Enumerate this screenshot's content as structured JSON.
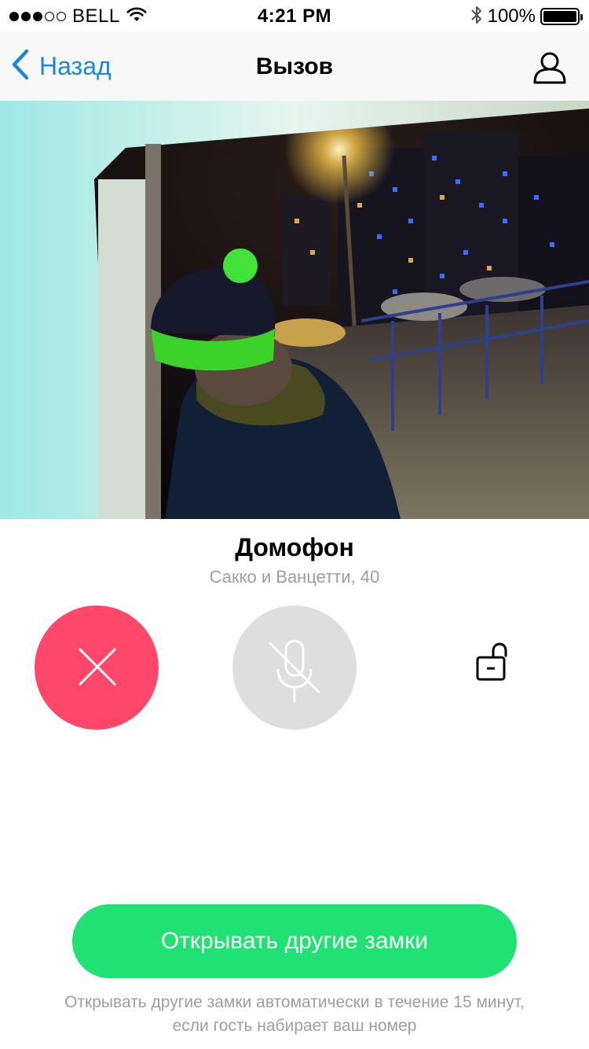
{
  "status_bar": {
    "carrier": "BELL",
    "time": "4:21 PM",
    "battery": "100%",
    "signal_bars_filled": 3,
    "signal_bars_total": 5
  },
  "nav": {
    "back_label": "Назад",
    "title": "Вызов",
    "profile_icon": "user-icon"
  },
  "caller": {
    "name": "Домофон",
    "address": "Сакко и Ванцетти, 40"
  },
  "actions": {
    "decline_icon": "close-icon",
    "mute_icon": "microphone-off-icon",
    "unlock_icon": "unlock-icon"
  },
  "bottom": {
    "open_other_label": "Открывать другие замки",
    "hint_line1": "Открывать другие замки автоматически в течение 15 минут,",
    "hint_line2": "если гость набирает ваш номер"
  },
  "colors": {
    "accent_blue": "#1a88d6",
    "decline_red": "#ff476a",
    "mute_grey": "#dedede",
    "open_green": "#1fe273",
    "secondary_text": "#9e9e9e"
  }
}
